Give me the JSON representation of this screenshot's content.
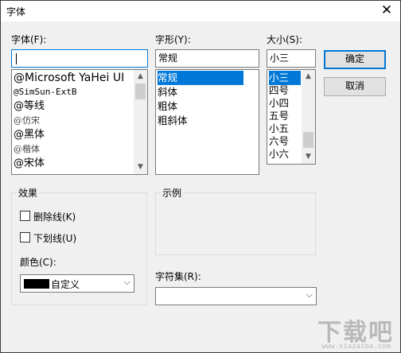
{
  "window": {
    "title": "字体",
    "close_glyph": "✕"
  },
  "font": {
    "label": "字体(F):",
    "value": "",
    "items": [
      "@Microsoft YaHei UI",
      "@SimSun-ExtB",
      "@等线",
      "@仿宋",
      "@黑体",
      "@楷体",
      "@宋体"
    ]
  },
  "style": {
    "label": "字形(Y):",
    "value": "常规",
    "items": [
      "常规",
      "斜体",
      "粗体",
      "粗斜体"
    ],
    "selected": "常规"
  },
  "size": {
    "label": "大小(S):",
    "value": "小三",
    "items": [
      "小三",
      "四号",
      "小四",
      "五号",
      "小五",
      "六号",
      "小六"
    ],
    "selected": "小三"
  },
  "buttons": {
    "ok": "确定",
    "cancel": "取消"
  },
  "effects": {
    "label": "效果",
    "strikeout": "删除线(K)",
    "underline": "下划线(U)",
    "strikeout_checked": false,
    "underline_checked": false
  },
  "color": {
    "label": "颜色(C):",
    "value": "自定义",
    "swatch": "#000000"
  },
  "sample": {
    "label": "示例"
  },
  "charset": {
    "label": "字符集(R):",
    "value": ""
  },
  "watermark": {
    "text": "下载吧",
    "sub": "www.xiazaiba.com"
  }
}
